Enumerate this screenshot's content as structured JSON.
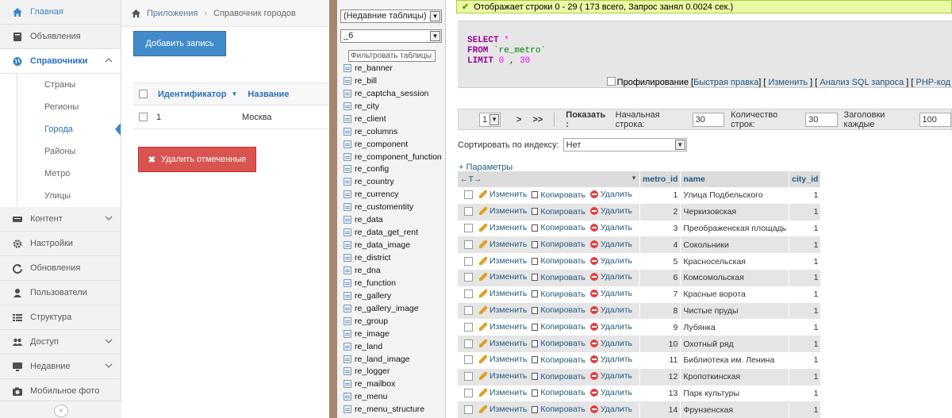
{
  "sidebar": {
    "items": [
      {
        "label": "Главная",
        "icon": "home-icon"
      },
      {
        "label": "Объявления",
        "icon": "book-icon"
      },
      {
        "label": "Справочники",
        "icon": "globe-icon"
      },
      {
        "label": "Контент",
        "icon": "keyboard-icon"
      },
      {
        "label": "Настройки",
        "icon": "gear-icon"
      },
      {
        "label": "Обновления",
        "icon": "refresh-icon"
      },
      {
        "label": "Пользователи",
        "icon": "user-icon"
      },
      {
        "label": "Структура",
        "icon": "list-icon"
      },
      {
        "label": "Доступ",
        "icon": "users-icon"
      },
      {
        "label": "Недавние",
        "icon": "monitor-icon"
      },
      {
        "label": "Мобильное фото",
        "icon": "camera-icon"
      }
    ],
    "sub_items": [
      "Страны",
      "Регионы",
      "Города",
      "Районы",
      "Метро",
      "Улицы"
    ]
  },
  "main": {
    "breadcrumb": [
      "Приложения",
      "Справочник городов"
    ],
    "add_label": "Добавить запись",
    "columns": [
      "Идентификатор",
      "Название"
    ],
    "row": {
      "id": "1",
      "name": "Москва"
    },
    "delete_label": "Удалить отмеченные"
  },
  "pma_nav": {
    "recent": "(Недавние таблицы) ...",
    "db": "_6",
    "filter_placeholder": "Фильтровать таблицы",
    "tables": [
      "re_banner",
      "re_bill",
      "re_captcha_session",
      "re_city",
      "re_client",
      "re_columns",
      "re_component",
      "re_component_function",
      "re_config",
      "re_country",
      "re_currency",
      "re_customentity",
      "re_data",
      "re_data_get_rent",
      "re_data_image",
      "re_district",
      "re_dna",
      "re_function",
      "re_gallery",
      "re_gallery_image",
      "re_group",
      "re_image",
      "re_land",
      "re_land_image",
      "re_logger",
      "re_mailbox",
      "re_menu",
      "re_menu_structure"
    ]
  },
  "pma": {
    "success": "Отображает строки 0 - 29 ( 173 всего, Запрос занял 0.0024 сек.)",
    "sql": {
      "select": "SELECT",
      "star": "*",
      "from": "FROM",
      "table": "`re_metro`",
      "limit": "LIMIT",
      "offset": "0",
      "comma": ",",
      "count": "30"
    },
    "links": {
      "profiling": "Профилирование",
      "inline": "Быстрая правка",
      "edit": "Изменить",
      "explain": "Анализ SQL запроса",
      "php": "PHP-код"
    },
    "nav": {
      "page": "1",
      "next": ">",
      "last": ">>",
      "show": "Показать :",
      "start_label": "Начальная строка:",
      "start": "30",
      "count_label": "Количество строк:",
      "count": "30",
      "headers_label": "Заголовки каждые",
      "headers": "100"
    },
    "sort_label": "Сортировать по индексу:",
    "sort_value": "Нет",
    "params": "+ Параметры",
    "columns": {
      "arrows": "←T→",
      "metro_id": "metro_id",
      "name": "name",
      "city_id": "city_id"
    },
    "actions": {
      "edit": "Изменить",
      "copy": "Копировать",
      "delete": "Удалить"
    },
    "rows": [
      {
        "metro_id": "1",
        "name": "Улица Подбельского",
        "city_id": "1"
      },
      {
        "metro_id": "2",
        "name": "Черкизовская",
        "city_id": "1"
      },
      {
        "metro_id": "3",
        "name": "Преображенская площадь",
        "city_id": "1"
      },
      {
        "metro_id": "4",
        "name": "Сокольники",
        "city_id": "1"
      },
      {
        "metro_id": "5",
        "name": "Красносельская",
        "city_id": "1"
      },
      {
        "metro_id": "6",
        "name": "Комсомольская",
        "city_id": "1"
      },
      {
        "metro_id": "7",
        "name": "Красные ворота",
        "city_id": "1"
      },
      {
        "metro_id": "8",
        "name": "Чистые пруды",
        "city_id": "1"
      },
      {
        "metro_id": "9",
        "name": "Лубянка",
        "city_id": "1"
      },
      {
        "metro_id": "10",
        "name": "Охотный ряд",
        "city_id": "1"
      },
      {
        "metro_id": "11",
        "name": "Библиотека им. Ленина",
        "city_id": "1"
      },
      {
        "metro_id": "12",
        "name": "Кропоткинская",
        "city_id": "1"
      },
      {
        "metro_id": "13",
        "name": "Парк культуры",
        "city_id": "1"
      },
      {
        "metro_id": "14",
        "name": "Фрунзенская",
        "city_id": "1"
      }
    ]
  }
}
